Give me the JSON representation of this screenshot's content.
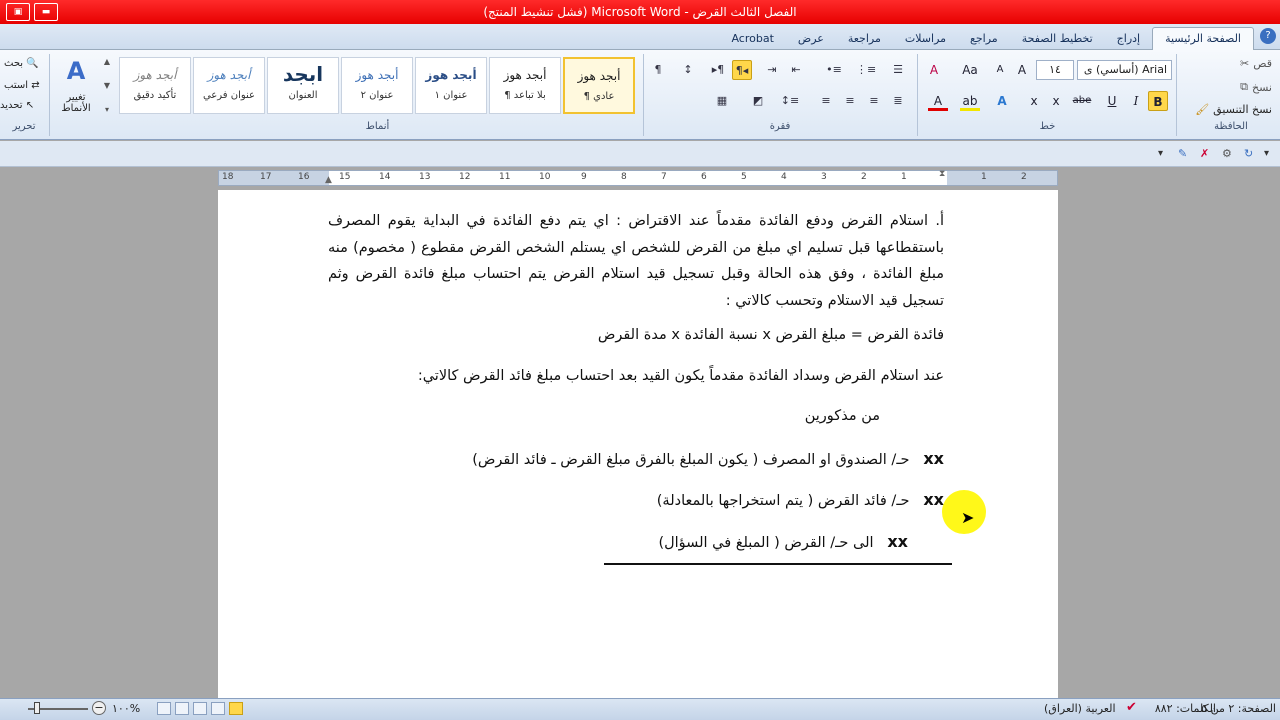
{
  "window": {
    "title": "الفصل الثالث القرض - Microsoft Word (فشل تنشيط المنتج)"
  },
  "quick_access": [
    "▣",
    "▬"
  ],
  "tabs": [
    "الصفحة الرئيسية",
    "إدراج",
    "تخطيط الصفحة",
    "مراجع",
    "مراسلات",
    "مراجعة",
    "عرض",
    "Acrobat"
  ],
  "active_tab": "الصفحة الرئيسية",
  "help_icon": "?",
  "ribbon": {
    "clipboard": {
      "label": "الحافظة",
      "cut": "قص",
      "copy": "نسخ",
      "format_painter": "نسخ التنسيق"
    },
    "font": {
      "label": "خط",
      "font_name": "Arial (أساسي) ى",
      "font_size": "١٤",
      "grow": "A",
      "shrink": "A",
      "case": "Aa",
      "clear": "A",
      "bold": "B",
      "italic": "I",
      "underline": "U",
      "strike": "abe",
      "subscript": "x",
      "superscript": "x",
      "font_color": "A",
      "highlight": "ab",
      "text_effects": "A"
    },
    "paragraph": {
      "label": "فقرة",
      "show_marks": "¶"
    },
    "styles": {
      "label": "أنماط",
      "items": [
        {
          "sample": "أبجد هوز",
          "name": "¶ عادي"
        },
        {
          "sample": "أبجد هوز",
          "name": "¶ بلا تباعد"
        },
        {
          "sample": "أبجد هوز",
          "name": "عنوان ١"
        },
        {
          "sample": "أبجد هوز",
          "name": "عنوان ٢"
        },
        {
          "sample": "ابجد",
          "name": "العنوان"
        },
        {
          "sample": "أبجد هوز",
          "name": "عنوان فرعي"
        },
        {
          "sample": "أبجد هوز",
          "name": "تأكيد دقيق"
        }
      ],
      "change_styles": "تغيير الأنماط"
    },
    "editing": {
      "label": "تحرير",
      "find": "بحث",
      "replace": "استب",
      "select": "تحديد"
    }
  },
  "ruler": {
    "ticks": [
      "18",
      "17",
      "16",
      "15",
      "14",
      "13",
      "12",
      "11",
      "10",
      "9",
      "8",
      "7",
      "6",
      "5",
      "4",
      "3",
      "2",
      "1",
      "1",
      "2"
    ]
  },
  "document": {
    "p1": "أ. استلام القرض ودفع الفائدة مقدماً عند الاقتراض : اي يتم دفع الفائدة في البداية يقوم المصرف باستقطاعها قبل تسليم اي مبلغ من القرض للشخص اي يستلم الشخص القرض مقطوع ( مخصوم) منه مبلغ الفائدة ، وفق هذه الحالة وقبل تسجيل قيد استلام القرض يتم احتساب مبلغ فائدة القرض وثم تسجيل قيد الاستلام وتحسب كالاتي :",
    "formula": "فائدة القرض = مبلغ القرض x نسبة الفائدة x مدة القرض",
    "p2": "عند استلام القرض وسداد الفائدة مقدماً يكون القيد بعد احتساب مبلغ فائد القرض كالاتي:",
    "p3": "من مذكورين",
    "entry1_amount": "xx",
    "entry1_text": "حـ/ الصندوق او المصرف ( يكون المبلغ بالفرق مبلغ القرض ـ فائد القرض)",
    "entry2_amount": "xx",
    "entry2_text": "حـ/ فائد القرض ( يتم استخراجها بالمعادلة)",
    "entry3_amount": "xx",
    "entry3_text": "الى حـ/ القرض ( المبلغ في السؤال)"
  },
  "status": {
    "page": "الصفحة: ٢ من ٥",
    "words": "الكلمات: ٨٨٢",
    "language": "العربية (العراق)",
    "zoom": "%١٠٠"
  },
  "colors": {
    "title_bar": "#e60000",
    "highlight_yellow": "#ffd74a",
    "cursor_highlight": "#fff700"
  }
}
